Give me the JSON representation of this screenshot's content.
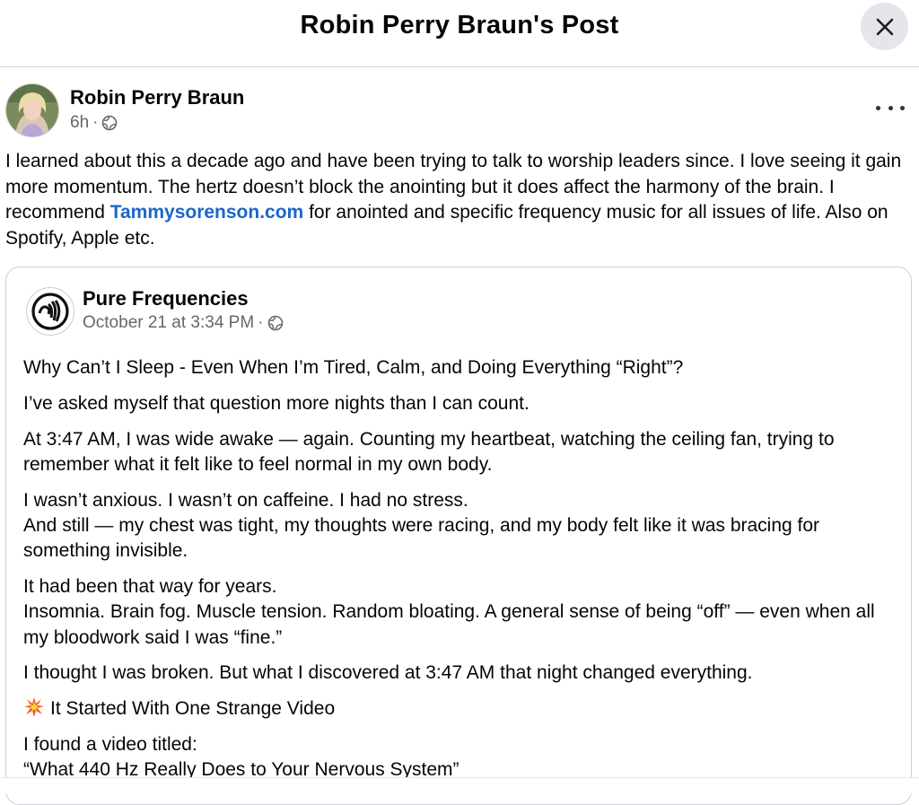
{
  "header": {
    "title": "Robin Perry Braun's Post",
    "close_icon": "close-icon"
  },
  "post": {
    "author": "Robin Perry Braun",
    "time": "6h",
    "separator": "·",
    "audience_icon": "globe-icon",
    "text_part1": "I learned about this a decade ago and have been trying to talk to worship leaders since. I love seeing it gain more momentum. The hertz doesn’t block the anointing but it does affect the harmony of the brain. I recommend ",
    "link": "Tammysorenson.com",
    "text_part2": " for anointed and specific frequency music for all issues of life.  Also on Spotify, Apple etc.",
    "more_icon": "more-options-icon"
  },
  "shared": {
    "page_name": "Pure Frequencies",
    "date": "October 21 at 3:34 PM",
    "separator": "·",
    "paragraphs": [
      "Why Can’t I Sleep - Even When I’m Tired, Calm, and Doing Everything “Right”?",
      "I’ve asked myself that question more nights than I can count.",
      "At 3:47 AM, I was wide awake — again. Counting my heartbeat, watching the ceiling fan, trying to remember what it felt like to feel normal in my own body.",
      "I wasn’t anxious. I wasn’t on caffeine. I had no stress.",
      "And still — my chest was tight, my thoughts were racing, and my body felt like it was bracing for something invisible.",
      "It had been that way for years.",
      "Insomnia. Brain fog. Muscle tension. Random bloating. A general sense of being “off” — even when all my bloodwork said I was “fine.”",
      "I thought I was broken. But what I discovered at 3:47 AM that night changed everything.",
      "It Started With One Strange Video",
      "I found a video titled:",
      "“What 440 Hz Really Does to Your Nervous System”"
    ]
  },
  "colors": {
    "link": "#1b66c9",
    "meta": "#65676b",
    "close_bg": "#e4e6eb"
  }
}
